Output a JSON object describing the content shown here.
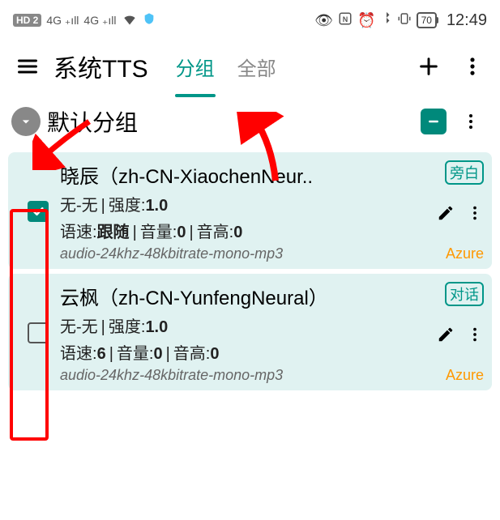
{
  "status": {
    "hd": "HD 2",
    "sig1": "4G",
    "sig2": "4G",
    "battery": "70",
    "time": "12:49"
  },
  "appbar": {
    "title": "系统TTS",
    "tabs": [
      {
        "label": "分组",
        "active": true
      },
      {
        "label": "全部",
        "active": false
      }
    ]
  },
  "group": {
    "title": "默认分组"
  },
  "cards": [
    {
      "title": "晓辰（zh-CN-XiaochenNeur..",
      "style_prefix": "无-无",
      "intensity_lbl": "强度:",
      "intensity": "1.0",
      "speed_lbl": "语速:",
      "speed": "跟随",
      "vol_lbl": "音量:",
      "vol": "0",
      "pitch_lbl": "音高:",
      "pitch": "0",
      "format": "audio-24khz-48kbitrate-mono-mp3",
      "role": "旁白",
      "provider": "Azure",
      "checked": true
    },
    {
      "title": "云枫（zh-CN-YunfengNeural）",
      "style_prefix": "无-无",
      "intensity_lbl": "强度:",
      "intensity": "1.0",
      "speed_lbl": "语速:",
      "speed": "6",
      "vol_lbl": "音量:",
      "vol": "0",
      "pitch_lbl": "音高:",
      "pitch": "0",
      "format": "audio-24khz-48kbitrate-mono-mp3",
      "role": "对话",
      "provider": "Azure",
      "checked": false
    }
  ]
}
